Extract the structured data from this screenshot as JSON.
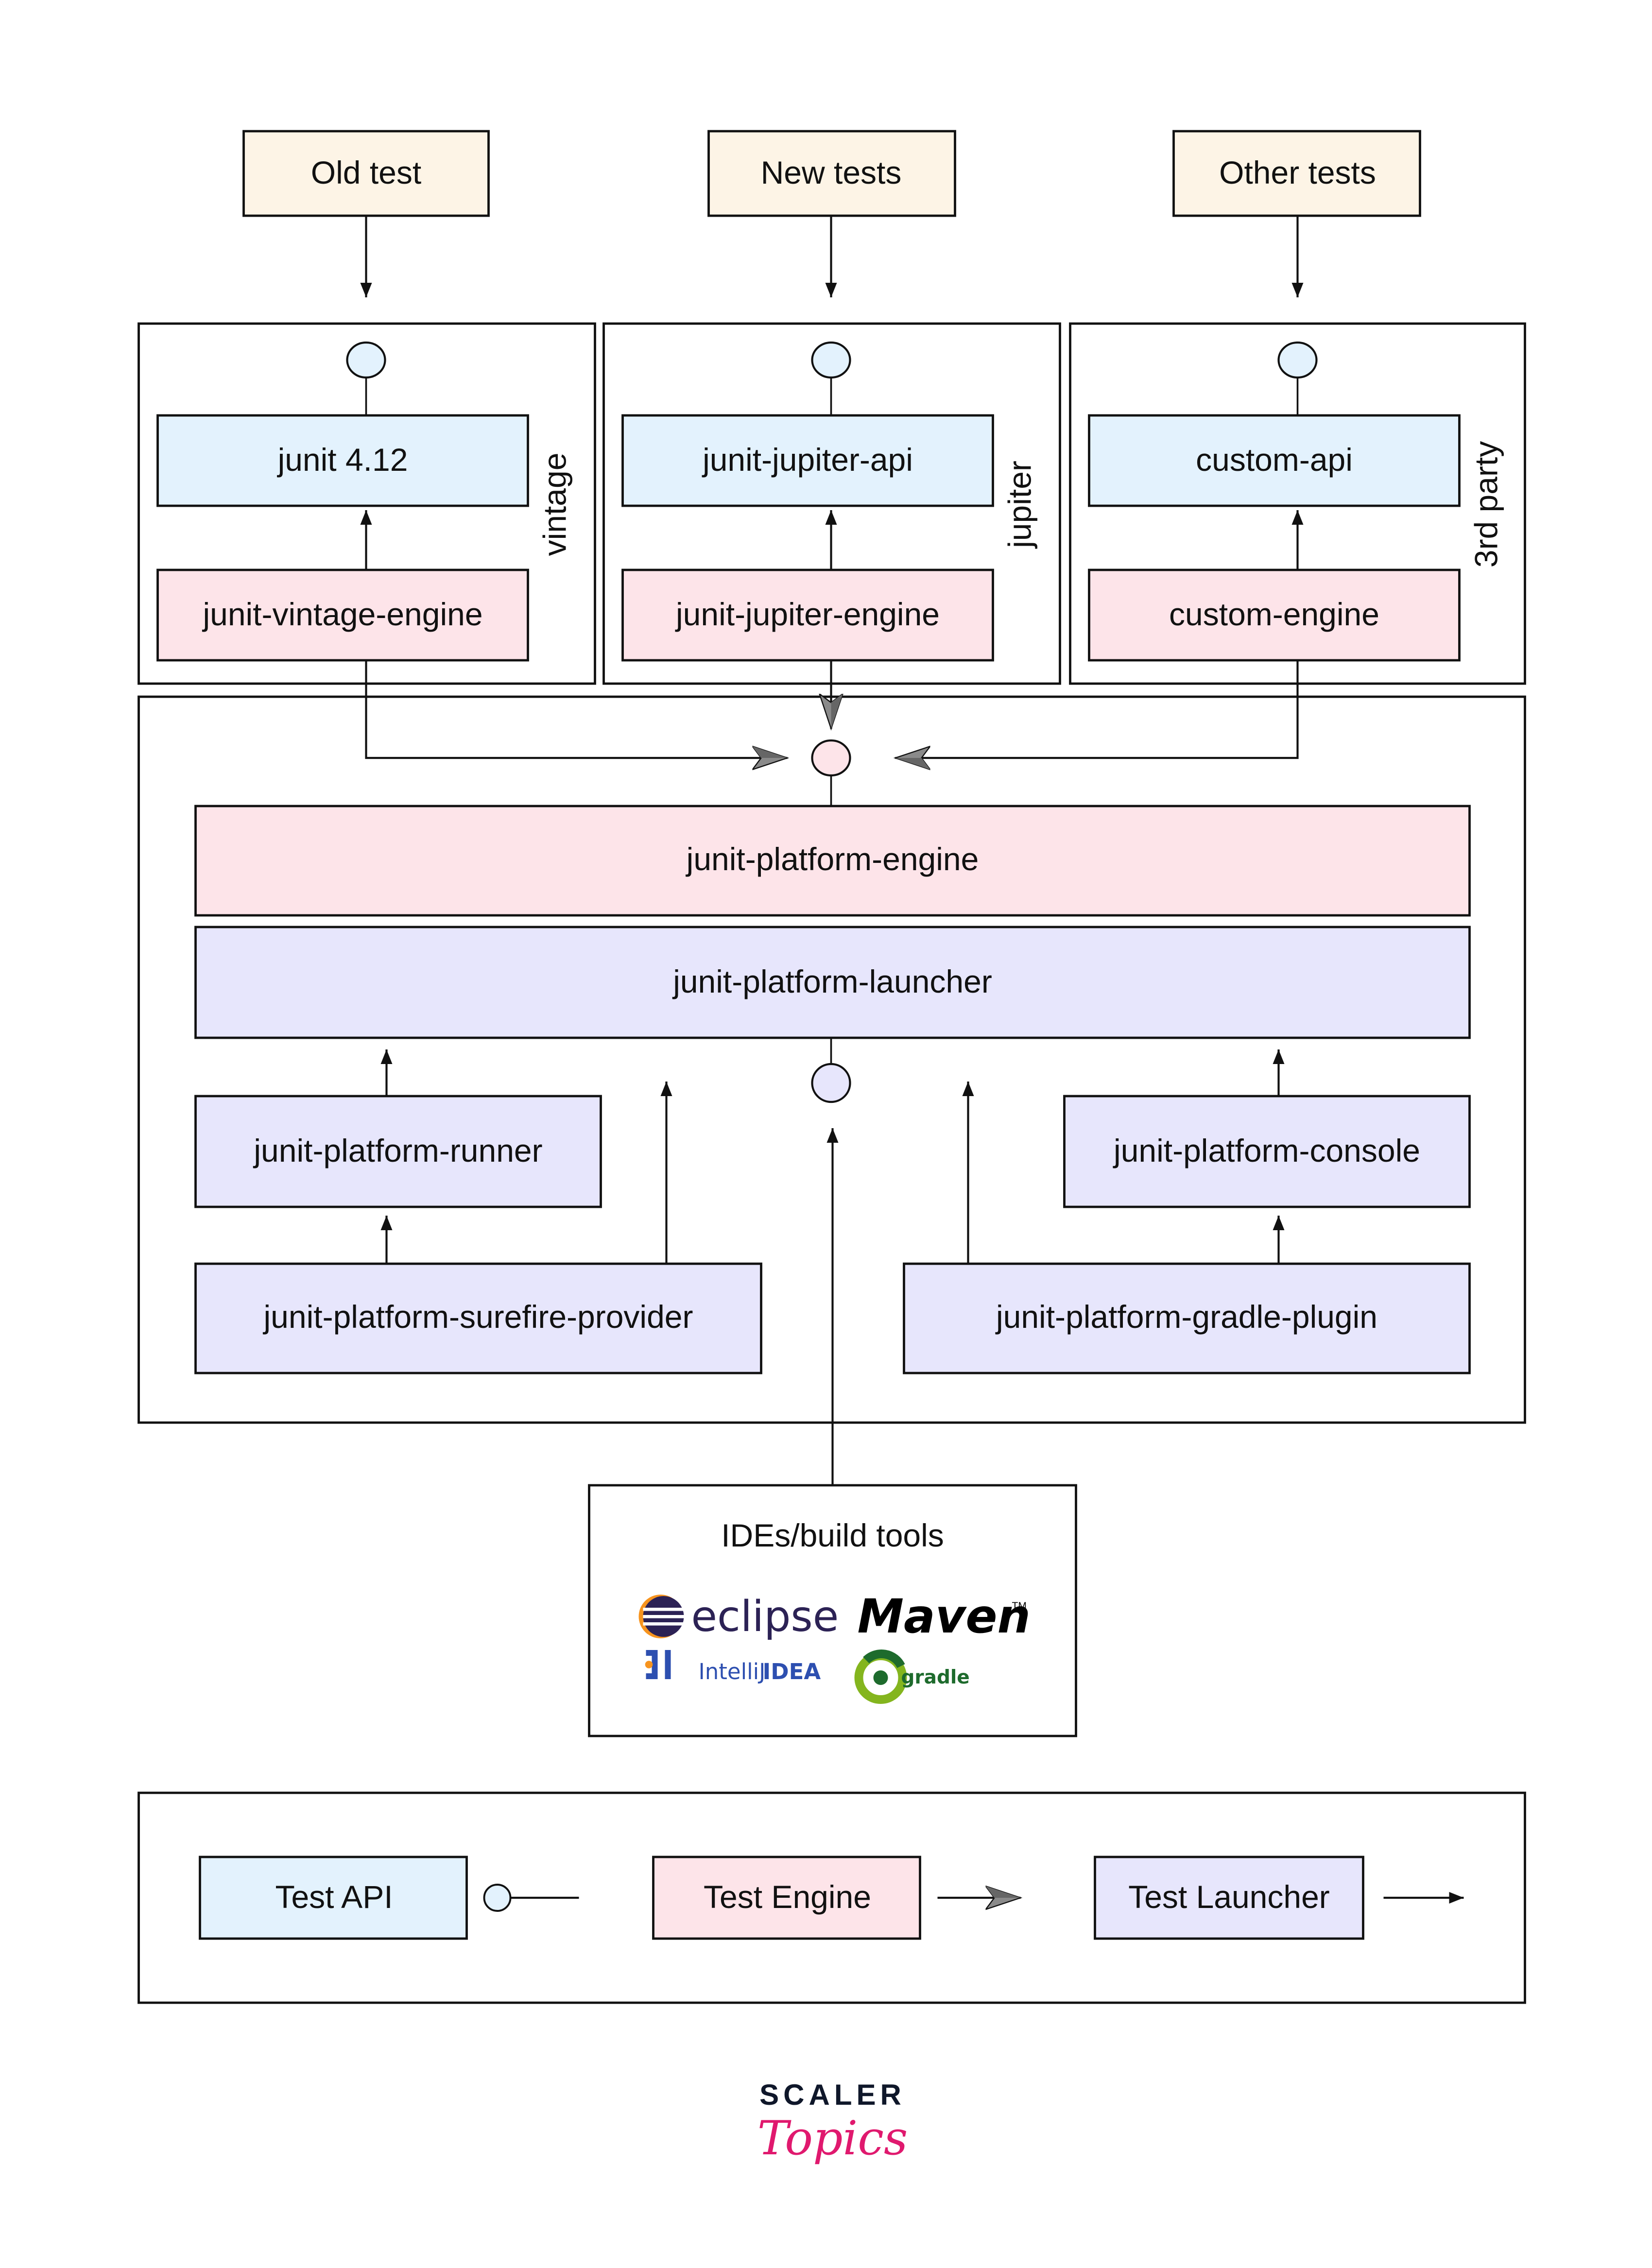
{
  "diagram": {
    "colors": {
      "test_source_fill": "#fdf4e6",
      "api_fill": "#e3f2fd",
      "engine_fill": "#fde4e9",
      "launcher_fill": "#e7e6fc",
      "stroke": "#111111",
      "barbed_arrow_fill": "#8a8a8a",
      "brand_dark": "#0f172a",
      "brand_pink": "#e0196e"
    },
    "test_sources": [
      {
        "id": "old",
        "label": "Old test"
      },
      {
        "id": "new",
        "label": "New tests"
      },
      {
        "id": "other",
        "label": "Other tests"
      }
    ],
    "groups": [
      {
        "id": "vintage",
        "side_label": "vintage",
        "api": "junit 4.12",
        "engine": "junit-vintage-engine"
      },
      {
        "id": "jupiter",
        "side_label": "jupiter",
        "api": "junit-jupiter-api",
        "engine": "junit-jupiter-engine"
      },
      {
        "id": "third-party",
        "side_label": "3rd party",
        "api": "custom-api",
        "engine": "custom-engine"
      }
    ],
    "platform": {
      "engine": "junit-platform-engine",
      "launcher": "junit-platform-launcher",
      "runner": "junit-platform-runner",
      "surefire": "junit-platform-surefire-provider",
      "console": "junit-platform-console",
      "gradle_plugin": "junit-platform-gradle-plugin"
    },
    "ide_box": {
      "title": "IDEs/build tools",
      "logos": [
        {
          "icon": "eclipse-logo-icon",
          "text": "eclipse"
        },
        {
          "icon": "maven-logo-icon",
          "text": "Maven"
        },
        {
          "icon": "intellij-logo-icon",
          "text_light": "IntelliJ",
          "text_bold": "IDEA"
        },
        {
          "icon": "gradle-logo-icon",
          "text": "gradle"
        }
      ]
    },
    "legend": [
      {
        "label": "Test API",
        "connector": "interface-lollipop"
      },
      {
        "label": "Test Engine",
        "connector": "barbed-arrow"
      },
      {
        "label": "Test Launcher",
        "connector": "solid-arrow"
      }
    ]
  },
  "branding": {
    "top": "SCALER",
    "bottom": "Topics"
  }
}
